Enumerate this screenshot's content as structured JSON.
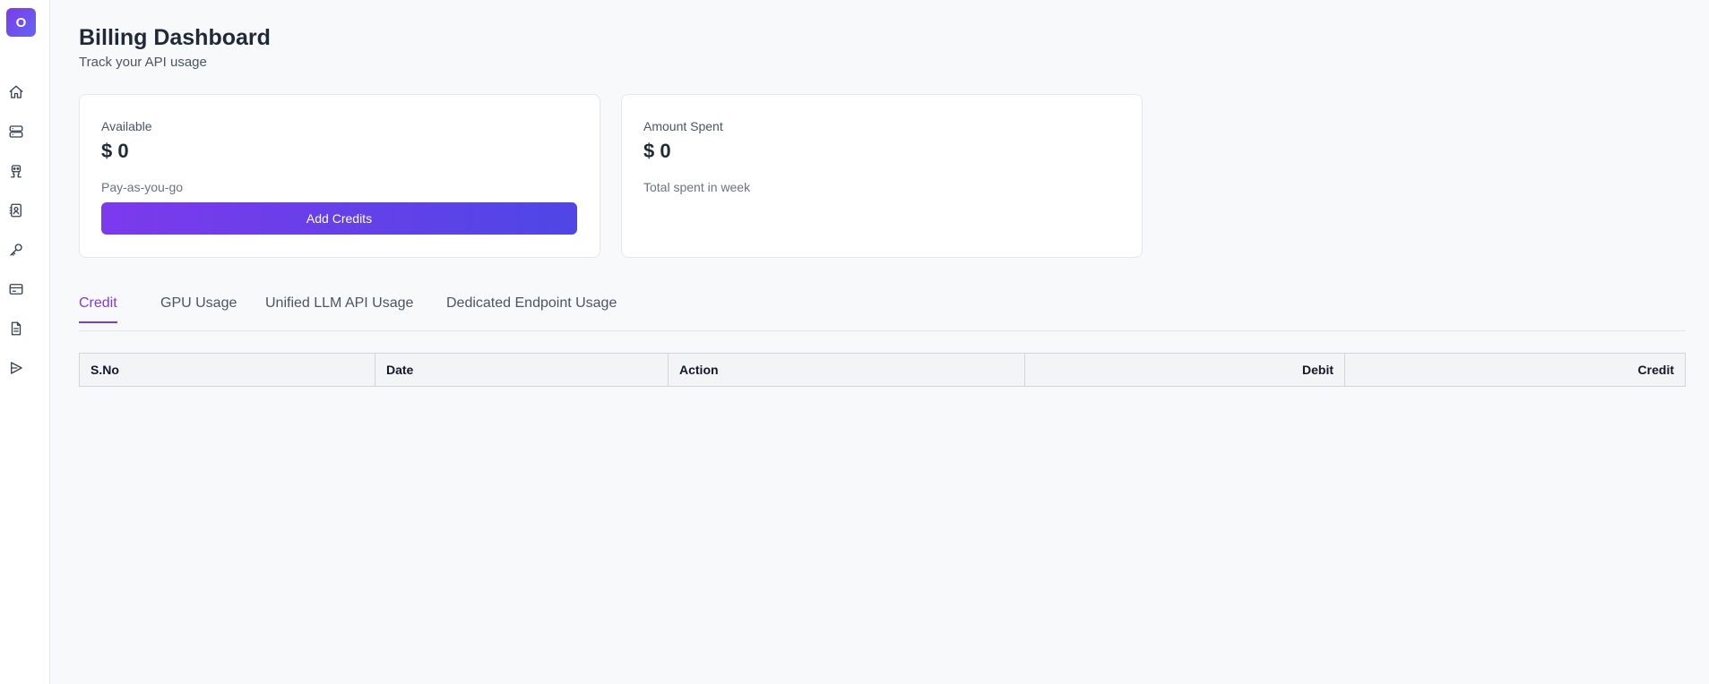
{
  "sidebar": {
    "logo_letter": "O",
    "items": [
      {
        "icon": "home-icon"
      },
      {
        "icon": "server-icon"
      },
      {
        "icon": "robot-icon"
      },
      {
        "icon": "contacts-icon"
      },
      {
        "icon": "key-icon"
      },
      {
        "icon": "credit-card-icon"
      },
      {
        "icon": "document-icon"
      },
      {
        "icon": "send-icon"
      }
    ]
  },
  "header": {
    "title": "Billing Dashboard",
    "subtitle": "Track your API usage"
  },
  "cards": {
    "available": {
      "label": "Available",
      "value": "$ 0",
      "note": "Pay-as-you-go",
      "button": "Add Credits"
    },
    "spent": {
      "label": "Amount Spent",
      "value": "$ 0",
      "note": "Total spent in week"
    }
  },
  "tabs": [
    {
      "label": "Credit",
      "active": true
    },
    {
      "label": "GPU Usage",
      "active": false
    },
    {
      "label": "Unified LLM API Usage",
      "active": false
    },
    {
      "label": "Dedicated Endpoint Usage",
      "active": false
    }
  ],
  "table": {
    "columns": [
      "S.No",
      "Date",
      "Action",
      "Debit",
      "Credit"
    ]
  },
  "colors": {
    "accent": "#7c3aed",
    "accent_end": "#4f46e5"
  }
}
